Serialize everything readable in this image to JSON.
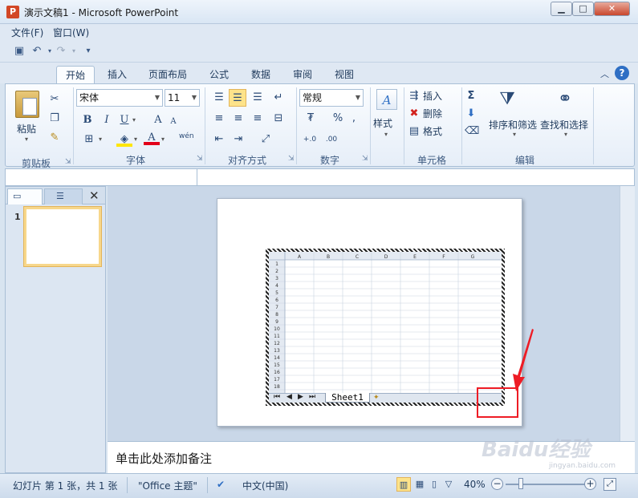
{
  "window": {
    "app_icon": "P",
    "title": "演示文稿1 - Microsoft PowerPoint",
    "min_icon": "minimize-icon",
    "max_icon": "maximize-icon",
    "close_icon": "close-icon"
  },
  "menu": {
    "items": [
      "文件(F)",
      "窗口(W)"
    ]
  },
  "ribbon_tabs": [
    "开始",
    "插入",
    "页面布局",
    "公式",
    "数据",
    "审阅",
    "视图"
  ],
  "ribbon": {
    "clipboard": {
      "paste": "粘贴",
      "label": "剪贴板"
    },
    "font": {
      "family": "宋体",
      "size": "11",
      "bold": "B",
      "italic": "I",
      "underline": "U",
      "label": "字体",
      "grow": "A",
      "shrink": "A",
      "wen": "wén"
    },
    "alignment": {
      "label": "对齐方式"
    },
    "number": {
      "format": "常规",
      "percent": "%",
      "comma": ",",
      "label": "数字",
      "inc_decimal": "+.0",
      "dec_decimal": ".00"
    },
    "styles": {
      "label": "样式"
    },
    "cells": {
      "insert": "插入",
      "delete": "删除",
      "format": "格式",
      "label": "单元格"
    },
    "editing": {
      "sigma": "Σ",
      "sort_filter": "排序和筛选",
      "find_select": "查找和选择",
      "label": "编辑"
    }
  },
  "slides_panel": {
    "slide_number": "1"
  },
  "sheet": {
    "columns": [
      "A",
      "B",
      "C",
      "D",
      "E",
      "F",
      "G"
    ],
    "rows": [
      "1",
      "2",
      "3",
      "4",
      "5",
      "6",
      "7",
      "8",
      "9",
      "10",
      "11",
      "12",
      "13",
      "14",
      "15",
      "16",
      "17",
      "18"
    ],
    "tab_name": "Sheet1"
  },
  "notes": {
    "placeholder": "单击此处添加备注"
  },
  "watermark": {
    "text": "Baidu经验",
    "sub": "jingyan.baidu.com"
  },
  "status": {
    "slide_info": "幻灯片 第 1 张，共 1 张",
    "theme": "\"Office 主题\"",
    "language": "中文(中国)",
    "zoom": "40%"
  }
}
